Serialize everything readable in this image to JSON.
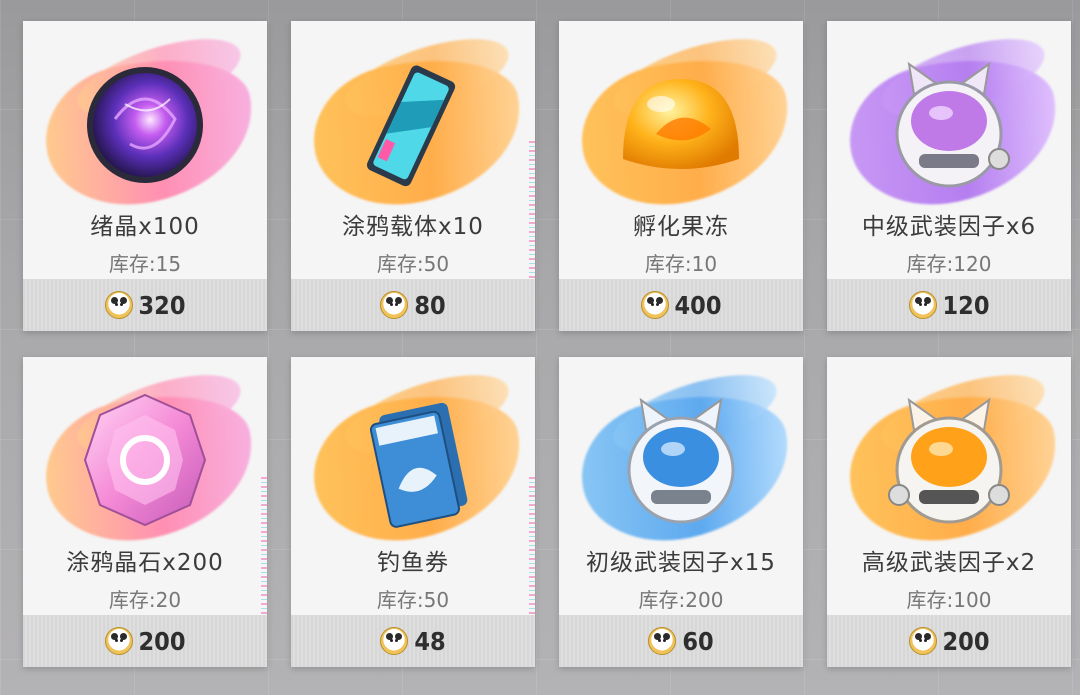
{
  "shop": {
    "currency_icon": "panda-coin-icon",
    "items": [
      {
        "name": "绪晶x100",
        "stock": "库存:15",
        "price": "320",
        "icon": "purple-orb-icon",
        "accent": "#ff8fb3"
      },
      {
        "name": "涂鸦载体x10",
        "stock": "库存:50",
        "price": "80",
        "icon": "spray-can-icon",
        "accent": "#ffad4a"
      },
      {
        "name": "孵化果冻",
        "stock": "库存:10",
        "price": "400",
        "icon": "orange-jelly-icon",
        "accent": "#ffad4a"
      },
      {
        "name": "中级武装因子x6",
        "stock": "库存:120",
        "price": "120",
        "icon": "purple-cat-helmet-icon",
        "accent": "#b57ef0"
      },
      {
        "name": "涂鸦晶石x200",
        "stock": "库存:20",
        "price": "200",
        "icon": "pink-crystal-icon",
        "accent": "#ff8fb3"
      },
      {
        "name": "钓鱼券",
        "stock": "库存:50",
        "price": "48",
        "icon": "fishing-ticket-icon",
        "accent": "#ffad4a"
      },
      {
        "name": "初级武装因子x15",
        "stock": "库存:200",
        "price": "60",
        "icon": "blue-cat-helmet-icon",
        "accent": "#5da9ef"
      },
      {
        "name": "高级武装因子x2",
        "stock": "库存:100",
        "price": "200",
        "icon": "orange-cat-helmet-icon",
        "accent": "#ffad4a"
      }
    ]
  }
}
